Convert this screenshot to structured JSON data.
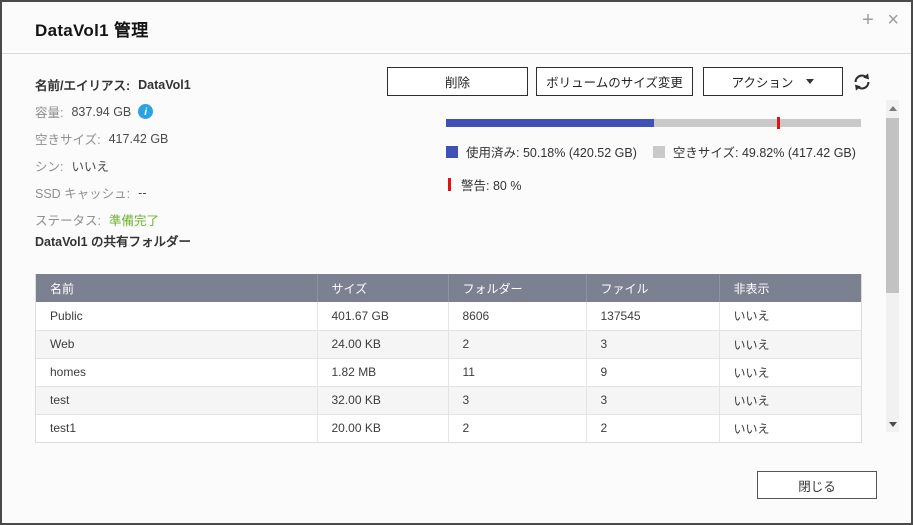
{
  "window": {
    "title": "DataVol1 管理",
    "maximize_glyph": "+",
    "close_glyph": "×"
  },
  "info": {
    "name_label": "名前/エイリアス:",
    "name_value": "DataVol1",
    "info_icon_glyph": "i",
    "rows": [
      {
        "label": "容量:",
        "value": "837.94 GB"
      },
      {
        "label": "空きサイズ:",
        "value": "417.42 GB"
      },
      {
        "label": "シン:",
        "value": "いいえ"
      },
      {
        "label": "SSD キャッシュ:",
        "value": "--"
      },
      {
        "label": "ステータス:",
        "value": "準備完了"
      }
    ]
  },
  "toolbar": {
    "delete_label": "削除",
    "resize_label": "ボリュームのサイズ変更",
    "action_label": "アクション"
  },
  "usage": {
    "used_percent": 50.18,
    "free_percent": 49.82,
    "warning_percent": 80,
    "used_gb": "420.52 GB",
    "free_gb": "417.42 GB",
    "used_label": "使用済み: 50.18% (420.52 GB)",
    "free_label": "空きサイズ: 49.82% (417.42 GB)",
    "warning_label": "警告: 80 %",
    "used_color": "#3f51b5",
    "free_color": "#c9c9c9",
    "warning_color": "#e01212"
  },
  "colors": {
    "status_ok": "#6fb32c",
    "info_icon": "#29a3e3",
    "table_header_bg": "#7b8191"
  },
  "shared_folders": {
    "section_title": "DataVol1 の共有フォルダー",
    "columns": [
      "名前",
      "サイズ",
      "フォルダー",
      "ファイル",
      "非表示"
    ],
    "rows": [
      [
        "Public",
        "401.67 GB",
        "8606",
        "137545",
        "いいえ"
      ],
      [
        "Web",
        "24.00 KB",
        "2",
        "3",
        "いいえ"
      ],
      [
        "homes",
        "1.82 MB",
        "11",
        "9",
        "いいえ"
      ],
      [
        "test",
        "32.00 KB",
        "3",
        "3",
        "いいえ"
      ],
      [
        "test1",
        "20.00 KB",
        "2",
        "2",
        "いいえ"
      ]
    ]
  },
  "footer": {
    "close_label": "閉じる"
  }
}
